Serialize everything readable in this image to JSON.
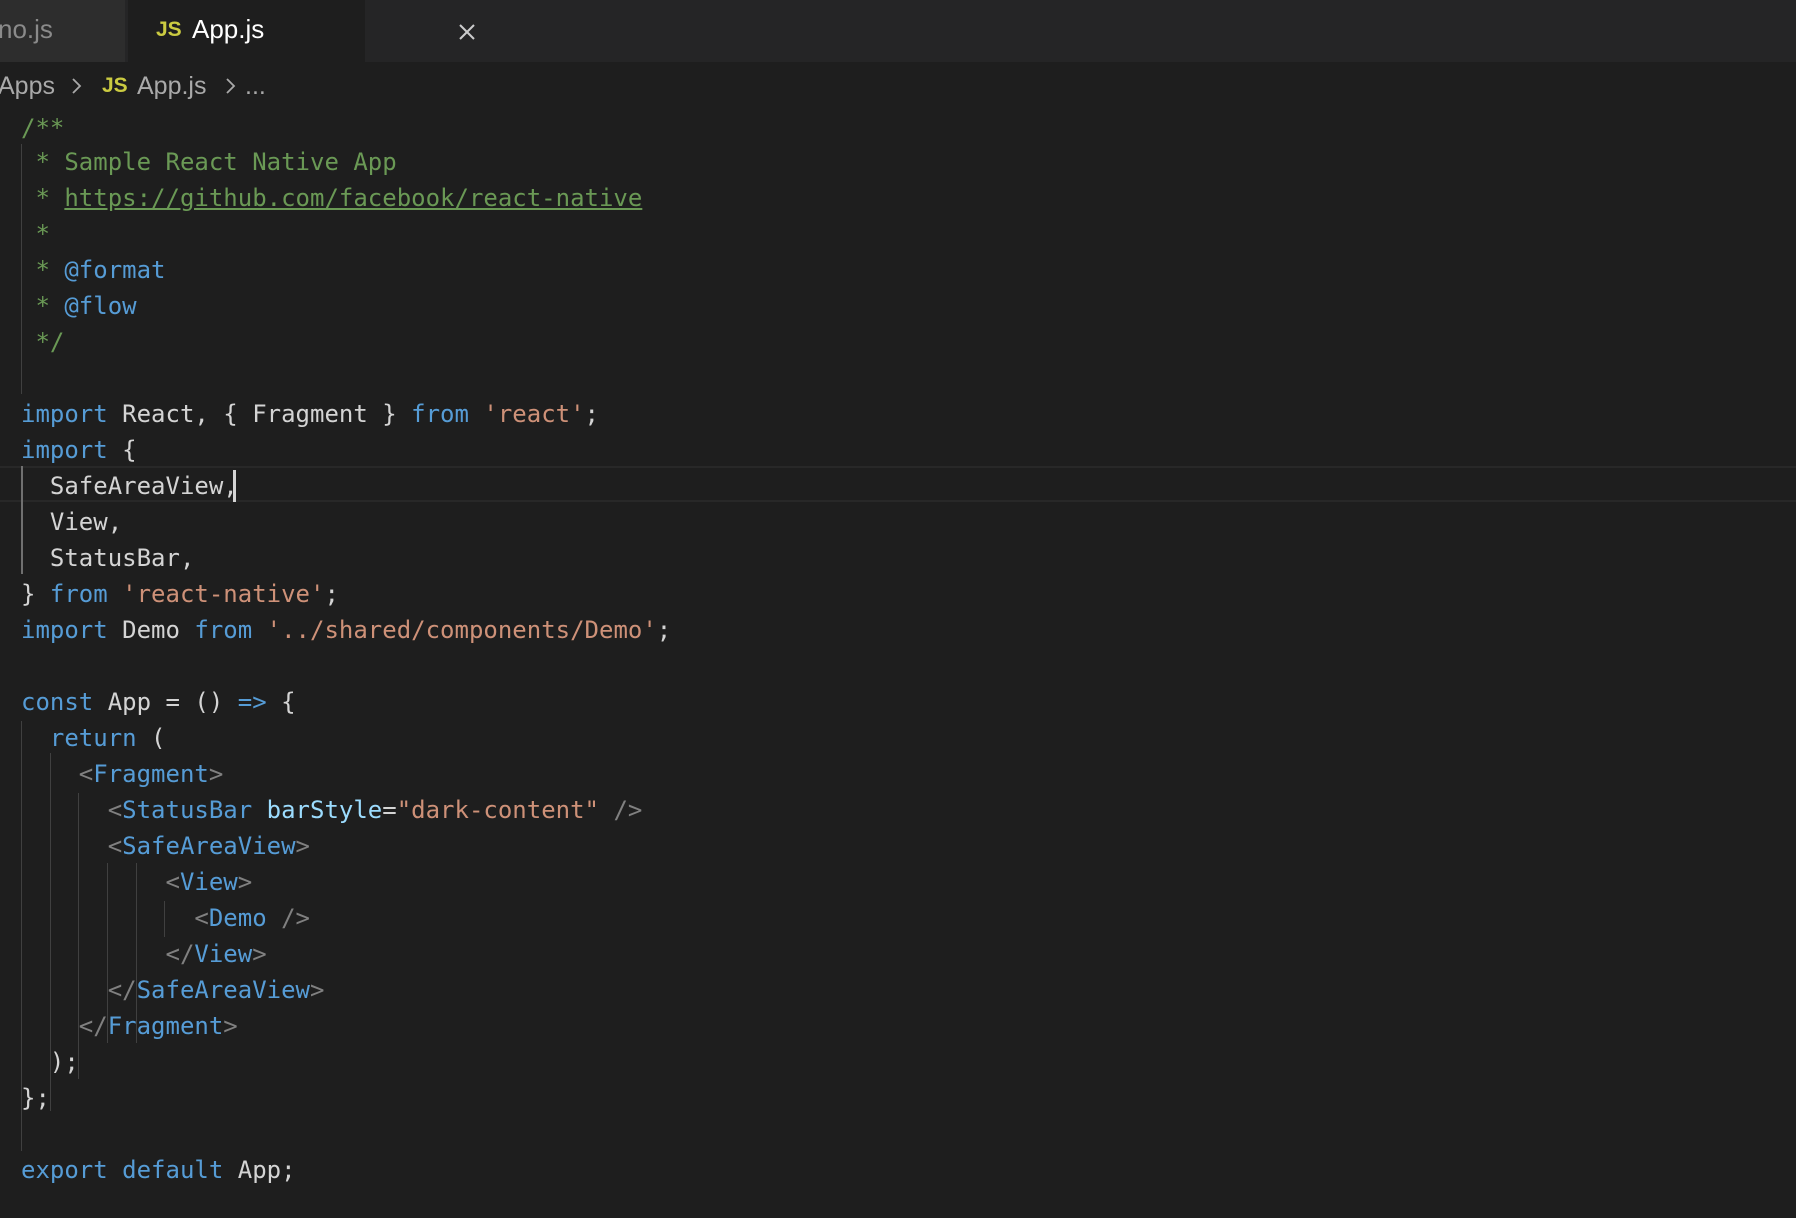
{
  "tabs": {
    "inactive_label": "no.js",
    "active_label": "App.js",
    "active_icon": "JS"
  },
  "breadcrumb": {
    "folder": "Apps",
    "file_icon": "JS",
    "file": "App.js",
    "more": "..."
  },
  "colors": {
    "comment": "#6a9955",
    "keyword": "#569cd6",
    "string": "#ce9178",
    "attribute": "#9cdcfe",
    "js_icon": "#cbcb41"
  },
  "code": {
    "l1": "/**",
    "l2_star": " * ",
    "l2_text": "Sample React Native App",
    "l3_star": " * ",
    "l3_link": "https://github.com/facebook/react-native",
    "l4": " *",
    "l5_star": " * ",
    "l5_tag": "@format",
    "l6_star": " * ",
    "l6_tag": "@flow",
    "l7": " */",
    "l9_kw1": "import",
    "l9_mid1": " React, { Fragment } ",
    "l9_kw2": "from",
    "l9_str": "'react'",
    "l9_end": ";",
    "l10_kw": "import",
    "l10_rest": " {",
    "l11": "  SafeAreaView,",
    "l12": "  View,",
    "l13": "  StatusBar,",
    "l14_brace": "} ",
    "l14_kw": "from",
    "l14_str": "'react-native'",
    "l14_end": ";",
    "l15_kw1": "import",
    "l15_mid": " Demo ",
    "l15_kw2": "from",
    "l15_str": "'../shared/components/Demo'",
    "l15_end": ";",
    "l17_kw": "const",
    "l17_mid": " App = () ",
    "l17_arrow": "=>",
    "l17_end": " {",
    "l18_kw": "return",
    "l18_end": " (",
    "l19_open": "<",
    "l19_tag": "Fragment",
    "l19_close": ">",
    "l20_open": "<",
    "l20_tag": "StatusBar",
    "l20_attr": "barStyle",
    "l20_eq": "=",
    "l20_str": "\"dark-content\"",
    "l20_close": " />",
    "l21_open": "<",
    "l21_tag": "SafeAreaView",
    "l21_close": ">",
    "l22_open": "<",
    "l22_tag": "View",
    "l22_close": ">",
    "l23_open": "<",
    "l23_tag": "Demo",
    "l23_close": " />",
    "l24_open": "</",
    "l24_tag": "View",
    "l24_close": ">",
    "l25_open": "</",
    "l25_tag": "SafeAreaView",
    "l25_close": ">",
    "l26_open": "</",
    "l26_tag": "Fragment",
    "l26_close": ">",
    "l27": ");",
    "l28": "};",
    "l30_kw1": "export",
    "l30_kw2": "default",
    "l30_end": " App;"
  }
}
